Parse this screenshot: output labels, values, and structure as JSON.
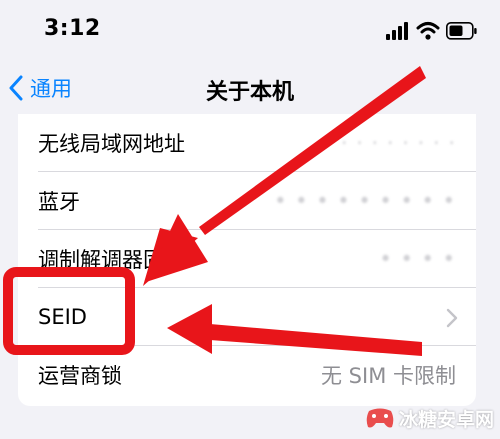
{
  "status_bar": {
    "time": "3:12",
    "icons": [
      "cellular-signal-icon",
      "wifi-icon",
      "battery-icon"
    ]
  },
  "nav": {
    "back_label": "通用",
    "title": "关于本机"
  },
  "settings_rows": [
    {
      "label": "无线局域网地址",
      "value": "· · · · · · · ·",
      "value_obscured": true
    },
    {
      "label": "蓝牙",
      "value": "• • • • • • • • •",
      "value_obscured": true
    },
    {
      "label": "调制解调器固件",
      "value": "• • • •",
      "value_obscured": true
    },
    {
      "label": "SEID",
      "value": "",
      "has_chevron": true
    },
    {
      "label": "运营商锁",
      "value": "无 SIM 卡限制"
    }
  ],
  "annotations": {
    "highlight_color": "#e8151a",
    "arrow_color": "#e8151a"
  },
  "watermark": {
    "text": "冰糖安卓网"
  },
  "colors": {
    "background": "#f2f2f7",
    "card": "#ffffff",
    "accent": "#0a84ff",
    "secondary_text": "#8e8e93"
  }
}
